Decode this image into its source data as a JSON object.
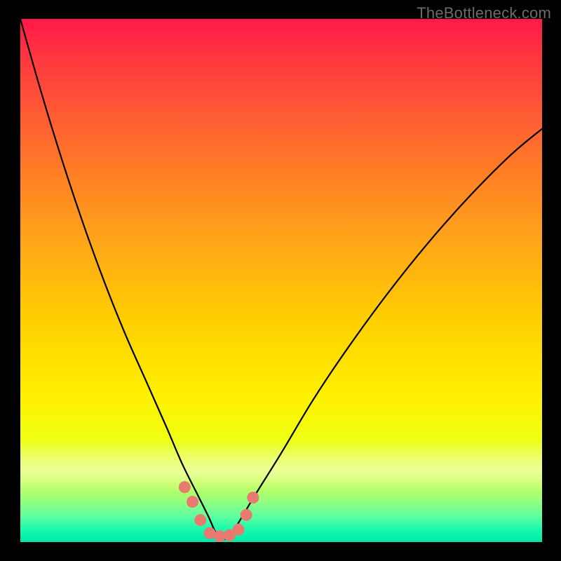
{
  "watermark": {
    "text": "TheBottleneck.com"
  },
  "colors": {
    "page_bg": "#000000",
    "curve_stroke": "#000000",
    "marker_fill": "#e97a6f",
    "marker_stroke": "#c64f45"
  },
  "chart_data": {
    "type": "line",
    "title": "",
    "xlabel": "",
    "ylabel": "",
    "xlim": [
      0,
      100
    ],
    "ylim": [
      0,
      100
    ],
    "grid": false,
    "legend": false,
    "note": "V-shaped bottleneck curve; y is visual percent from top (0=worst/red, 100=best/green). Minimum around x≈38 reaching ~99.",
    "series": [
      {
        "name": "bottleneck-curve",
        "x": [
          0,
          4,
          8,
          12,
          16,
          20,
          24,
          28,
          31,
          34,
          36,
          38,
          40,
          42,
          45,
          50,
          56,
          62,
          70,
          78,
          86,
          94,
          100
        ],
        "y": [
          0,
          14,
          27,
          39,
          50,
          60,
          69,
          78,
          85,
          91,
          95,
          99,
          99,
          96,
          91,
          83,
          73,
          64,
          53,
          43,
          34,
          26,
          21
        ]
      }
    ],
    "markers": {
      "name": "highlight-dots",
      "x": [
        31.5,
        33.0,
        34.5,
        36.3,
        38.2,
        40.1,
        41.8,
        43.3,
        44.6
      ],
      "y": [
        89.5,
        92.3,
        95.8,
        98.3,
        98.9,
        98.7,
        97.6,
        94.8,
        91.5
      ]
    }
  }
}
